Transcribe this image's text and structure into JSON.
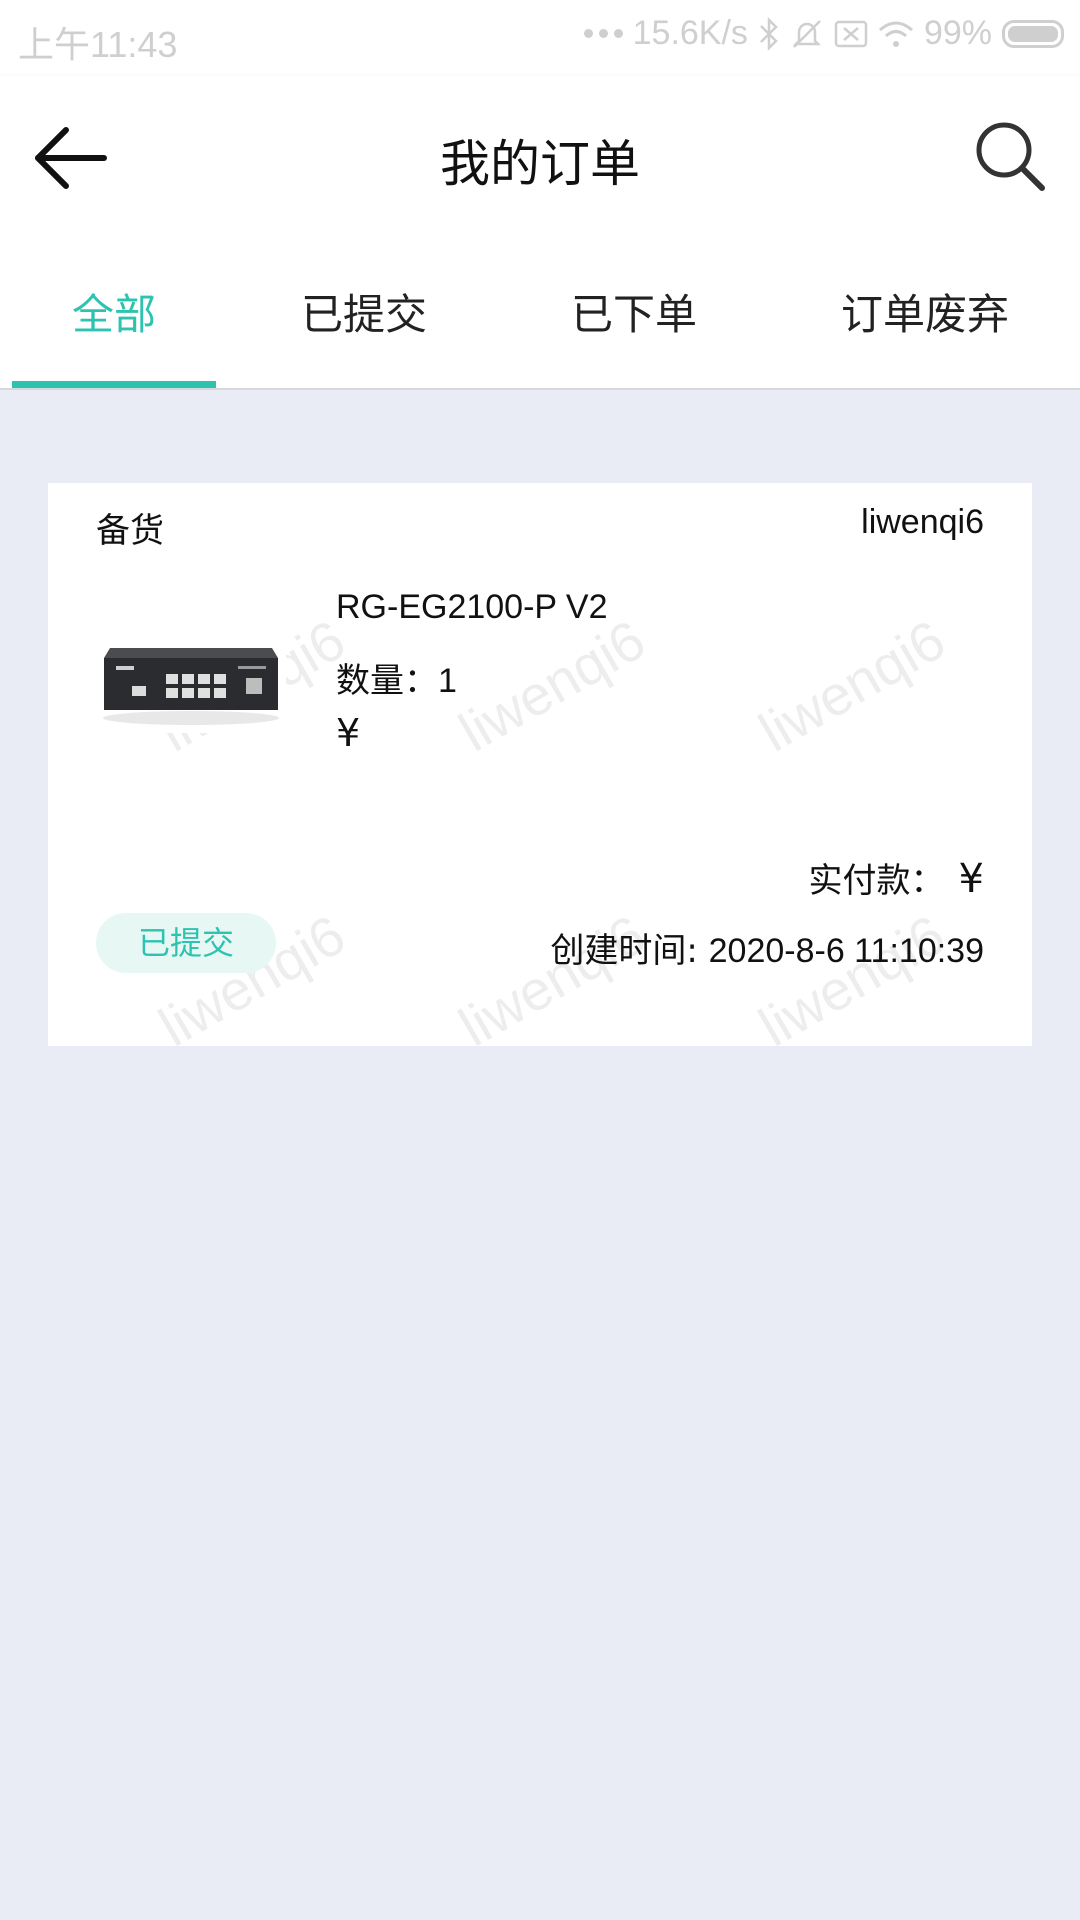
{
  "status_bar": {
    "time": "上午11:43",
    "network_speed": "15.6K/s",
    "battery": "99%",
    "icons": [
      "more-dots-icon",
      "bluetooth-icon",
      "mute-icon",
      "sim-icon",
      "wifi-icon",
      "battery-icon"
    ]
  },
  "app_bar": {
    "title": "我的订单",
    "back_icon": "arrow-left-icon",
    "search_icon": "search-icon"
  },
  "tabs": [
    {
      "label": "全部",
      "active": true
    },
    {
      "label": "已提交",
      "active": false
    },
    {
      "label": "已下单",
      "active": false
    },
    {
      "label": "订单废弃",
      "active": false
    }
  ],
  "order": {
    "stage": "备货",
    "user": "liwenqi6",
    "product": {
      "name": "RG-EG2100-P V2",
      "quantity_label": "数量：",
      "quantity": "1",
      "price": "¥",
      "image": "network-switch-photo"
    },
    "paid_label": "实付款：",
    "paid_amount": "¥",
    "status": "已提交",
    "created_label": "创建时间: ",
    "created_time": "2020-8-6 11:10:39"
  },
  "watermark": "liwenqi6",
  "colors": {
    "accent": "#2ec3b0",
    "background": "#e9ecf4",
    "badge_bg": "#e6f7f4"
  }
}
